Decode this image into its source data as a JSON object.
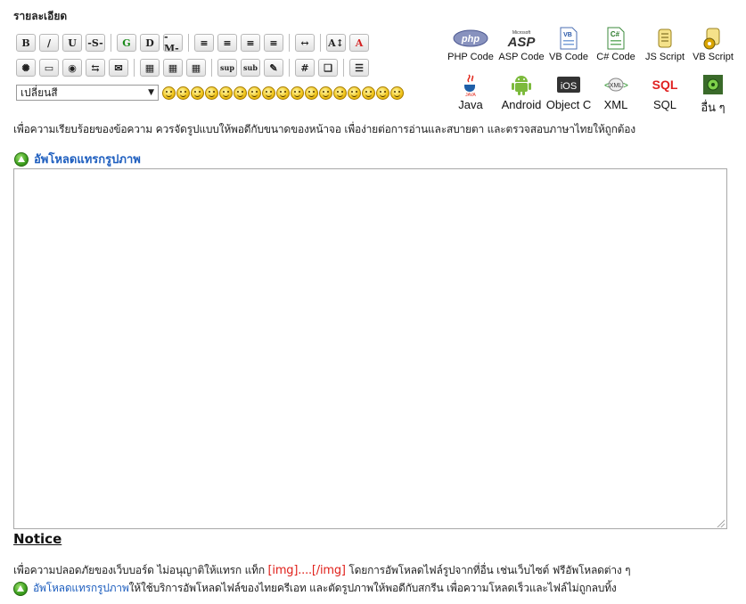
{
  "heading": "รายละเอียด",
  "toolbar": {
    "row1": [
      {
        "name": "bold-button",
        "label": "B"
      },
      {
        "name": "italic-button",
        "label": "/"
      },
      {
        "name": "underline-button",
        "label": "U"
      },
      {
        "name": "strikethrough-button",
        "label": "-S-"
      },
      {
        "sep": true
      },
      {
        "name": "glow-button",
        "label": "G"
      },
      {
        "name": "shadow-button",
        "label": "D"
      },
      {
        "name": "marquee-button",
        "label": "-M-"
      },
      {
        "sep": true
      },
      {
        "name": "align-left-button",
        "label": "≡"
      },
      {
        "name": "align-justify-button",
        "label": "≡"
      },
      {
        "name": "align-center-button",
        "label": "≡"
      },
      {
        "name": "align-right-button",
        "label": "≡"
      },
      {
        "sep": true
      },
      {
        "name": "horizontal-rule-button",
        "label": "↔"
      },
      {
        "sep": true
      },
      {
        "name": "font-size-button",
        "label": "A↕"
      },
      {
        "name": "font-color-button",
        "label": "A"
      }
    ],
    "row2": [
      {
        "name": "flash-button",
        "label": "✺"
      },
      {
        "name": "image-button",
        "label": "▭"
      },
      {
        "name": "hyperlink-button",
        "label": "◉"
      },
      {
        "name": "ftp-button",
        "label": "⇆"
      },
      {
        "name": "email-button",
        "label": "✉"
      },
      {
        "sep": true
      },
      {
        "name": "table-button",
        "label": "▦"
      },
      {
        "name": "table-row-button",
        "label": "▦"
      },
      {
        "name": "table-cell-button",
        "label": "▦"
      },
      {
        "sep": true
      },
      {
        "name": "superscript-button",
        "label": "sup"
      },
      {
        "name": "subscript-button",
        "label": "sub"
      },
      {
        "name": "teletype-button",
        "label": "✎"
      },
      {
        "sep": true
      },
      {
        "name": "code-button",
        "label": "#"
      },
      {
        "name": "quote-button",
        "label": "❑"
      },
      {
        "sep": true
      },
      {
        "name": "list-button",
        "label": "☰"
      }
    ],
    "color_select_value": "เปลี่ยนสี",
    "smiley_count": 17
  },
  "code_buttons": [
    {
      "label": "PHP Code",
      "icon": "php-icon",
      "col": 0,
      "row": 0
    },
    {
      "label": "ASP Code",
      "icon": "asp-icon",
      "col": 1,
      "row": 0
    },
    {
      "label": "VB Code",
      "icon": "vb-icon",
      "col": 2,
      "row": 0
    },
    {
      "label": "C# Code",
      "icon": "csharp-icon",
      "col": 3,
      "row": 0
    },
    {
      "label": "JS Script",
      "icon": "js-icon",
      "col": 4,
      "row": 0
    },
    {
      "label": "VB Script",
      "icon": "vbscript-icon",
      "col": 5,
      "row": 0
    },
    {
      "label": "Java",
      "icon": "java-icon",
      "col": 0,
      "row": 1
    },
    {
      "label": "Android",
      "icon": "android-icon",
      "col": 1,
      "row": 1
    },
    {
      "label": "Object C",
      "icon": "ios-icon",
      "col": 2,
      "row": 1
    },
    {
      "label": "XML",
      "icon": "xml-icon",
      "col": 3,
      "row": 1
    },
    {
      "label": "SQL",
      "icon": "sql-icon",
      "col": 4,
      "row": 1
    },
    {
      "label": "อื่น ๆ",
      "icon": "other-icon",
      "col": 5,
      "row": 1
    }
  ],
  "hint": "เพื่อความเรียบร้อยของข้อความ ควรจัดรูปแบบให้พอดีกับขนาดของหน้าจอ เพื่อง่ายต่อการอ่านและสบายตา และตรวจสอบภาษาไทยให้ถูกต้อง",
  "upload_label": "อัพโหลดแทรกรูปภาพ",
  "editor_value": "",
  "notice": {
    "title": "Notice",
    "line1_pre": "เพื่อความปลอดภัยของเว็บบอร์ด ไม่อนุญาติให้แทรก แท็ก ",
    "line1_tag": "[img]....[/img]",
    "line1_post": " โดยการอัพโหลดไฟล์รูปจากที่อื่น เช่นเว็บไซต์ ฟรีอัพโหลดต่าง ๆ",
    "line2_link": "อัพโหลดแทรกรูปภาพ",
    "line2_post": " ให้ใช้บริการอัพโหลดไฟล์ของไทยครีเอท และตัดรูปภาพให้พอดีกับสกรีน เพื่อความโหลดเร็วและไฟล์ไม่ถูกลบทิ้ง"
  }
}
